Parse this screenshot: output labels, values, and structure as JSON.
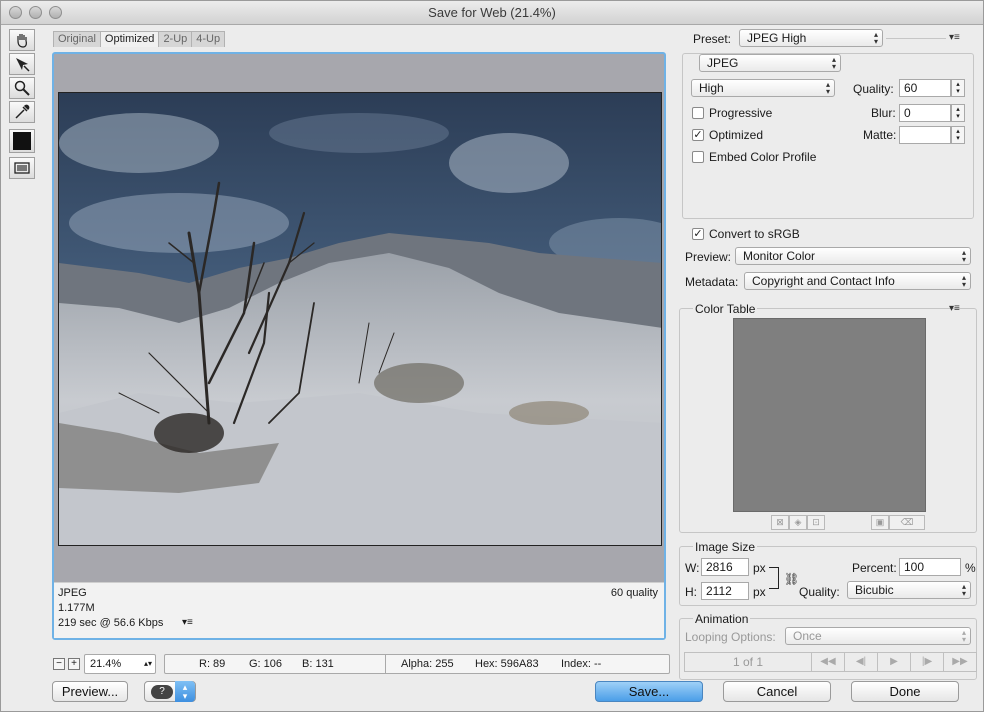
{
  "window": {
    "title": "Save for Web (21.4%)"
  },
  "tabs": [
    "Original",
    "Optimized",
    "2-Up",
    "4-Up"
  ],
  "image_info": {
    "format": "JPEG",
    "size": "1.177M",
    "time": "219 sec @ 56.6 Kbps",
    "quality": "60 quality"
  },
  "zoom": {
    "value": "21.4%"
  },
  "status": {
    "r": "R: 89",
    "g": "G: 106",
    "b": "B: 131",
    "alpha": "Alpha: 255",
    "hex": "Hex: 596A83",
    "index": "Index: --"
  },
  "buttons": {
    "preview": "Preview...",
    "save": "Save...",
    "cancel": "Cancel",
    "done": "Done"
  },
  "settings": {
    "preset_label": "Preset:",
    "preset": "JPEG High",
    "format": "JPEG",
    "compression": "High",
    "quality_label": "Quality:",
    "quality": "60",
    "blur_label": "Blur:",
    "blur": "0",
    "matte_label": "Matte:",
    "matte": "",
    "progressive": "Progressive",
    "optimized": "Optimized",
    "embed_profile": "Embed Color Profile",
    "convert_srgb": "Convert to sRGB",
    "preview_label": "Preview:",
    "preview_value": "Monitor Color",
    "metadata_label": "Metadata:",
    "metadata_value": "Copyright and Contact Info"
  },
  "color_table": {
    "title": "Color Table"
  },
  "image_size": {
    "title": "Image Size",
    "w_label": "W:",
    "w": "2816",
    "h_label": "H:",
    "h": "2112",
    "unit": "px",
    "percent_label": "Percent:",
    "percent": "100",
    "percent_unit": "%",
    "quality_label": "Quality:",
    "quality": "Bicubic"
  },
  "animation": {
    "title": "Animation",
    "looping_label": "Looping Options:",
    "looping": "Once",
    "frame": "1 of 1"
  },
  "colors": {
    "accent": "#6fb2e6",
    "save_button": "#5aa8ec"
  }
}
